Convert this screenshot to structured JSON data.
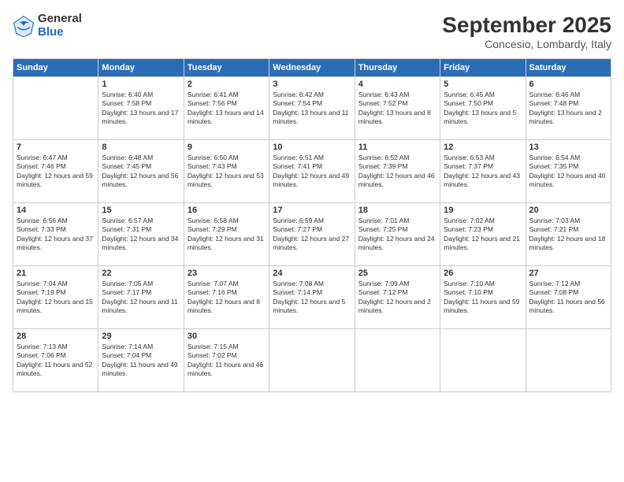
{
  "header": {
    "logo": {
      "general": "General",
      "blue": "Blue"
    },
    "title": "September 2025",
    "location": "Concesio, Lombardy, Italy"
  },
  "weekdays": [
    "Sunday",
    "Monday",
    "Tuesday",
    "Wednesday",
    "Thursday",
    "Friday",
    "Saturday"
  ],
  "weeks": [
    [
      null,
      {
        "day": "1",
        "sunrise": "6:40 AM",
        "sunset": "7:58 PM",
        "daylight": "13 hours and 17 minutes."
      },
      {
        "day": "2",
        "sunrise": "6:41 AM",
        "sunset": "7:56 PM",
        "daylight": "13 hours and 14 minutes."
      },
      {
        "day": "3",
        "sunrise": "6:42 AM",
        "sunset": "7:54 PM",
        "daylight": "13 hours and 11 minutes."
      },
      {
        "day": "4",
        "sunrise": "6:43 AM",
        "sunset": "7:52 PM",
        "daylight": "13 hours and 8 minutes."
      },
      {
        "day": "5",
        "sunrise": "6:45 AM",
        "sunset": "7:50 PM",
        "daylight": "13 hours and 5 minutes."
      },
      {
        "day": "6",
        "sunrise": "6:46 AM",
        "sunset": "7:48 PM",
        "daylight": "13 hours and 2 minutes."
      }
    ],
    [
      {
        "day": "7",
        "sunrise": "6:47 AM",
        "sunset": "7:46 PM",
        "daylight": "12 hours and 59 minutes."
      },
      {
        "day": "8",
        "sunrise": "6:48 AM",
        "sunset": "7:45 PM",
        "daylight": "12 hours and 56 minutes."
      },
      {
        "day": "9",
        "sunrise": "6:50 AM",
        "sunset": "7:43 PM",
        "daylight": "12 hours and 53 minutes."
      },
      {
        "day": "10",
        "sunrise": "6:51 AM",
        "sunset": "7:41 PM",
        "daylight": "12 hours and 49 minutes."
      },
      {
        "day": "11",
        "sunrise": "6:52 AM",
        "sunset": "7:39 PM",
        "daylight": "12 hours and 46 minutes."
      },
      {
        "day": "12",
        "sunrise": "6:53 AM",
        "sunset": "7:37 PM",
        "daylight": "12 hours and 43 minutes."
      },
      {
        "day": "13",
        "sunrise": "6:54 AM",
        "sunset": "7:35 PM",
        "daylight": "12 hours and 40 minutes."
      }
    ],
    [
      {
        "day": "14",
        "sunrise": "6:56 AM",
        "sunset": "7:33 PM",
        "daylight": "12 hours and 37 minutes."
      },
      {
        "day": "15",
        "sunrise": "6:57 AM",
        "sunset": "7:31 PM",
        "daylight": "12 hours and 34 minutes."
      },
      {
        "day": "16",
        "sunrise": "6:58 AM",
        "sunset": "7:29 PM",
        "daylight": "12 hours and 31 minutes."
      },
      {
        "day": "17",
        "sunrise": "6:59 AM",
        "sunset": "7:27 PM",
        "daylight": "12 hours and 27 minutes."
      },
      {
        "day": "18",
        "sunrise": "7:01 AM",
        "sunset": "7:25 PM",
        "daylight": "12 hours and 24 minutes."
      },
      {
        "day": "19",
        "sunrise": "7:02 AM",
        "sunset": "7:23 PM",
        "daylight": "12 hours and 21 minutes."
      },
      {
        "day": "20",
        "sunrise": "7:03 AM",
        "sunset": "7:21 PM",
        "daylight": "12 hours and 18 minutes."
      }
    ],
    [
      {
        "day": "21",
        "sunrise": "7:04 AM",
        "sunset": "7:19 PM",
        "daylight": "12 hours and 15 minutes."
      },
      {
        "day": "22",
        "sunrise": "7:05 AM",
        "sunset": "7:17 PM",
        "daylight": "12 hours and 11 minutes."
      },
      {
        "day": "23",
        "sunrise": "7:07 AM",
        "sunset": "7:16 PM",
        "daylight": "12 hours and 8 minutes."
      },
      {
        "day": "24",
        "sunrise": "7:08 AM",
        "sunset": "7:14 PM",
        "daylight": "12 hours and 5 minutes."
      },
      {
        "day": "25",
        "sunrise": "7:09 AM",
        "sunset": "7:12 PM",
        "daylight": "12 hours and 2 minutes."
      },
      {
        "day": "26",
        "sunrise": "7:10 AM",
        "sunset": "7:10 PM",
        "daylight": "11 hours and 59 minutes."
      },
      {
        "day": "27",
        "sunrise": "7:12 AM",
        "sunset": "7:08 PM",
        "daylight": "11 hours and 56 minutes."
      }
    ],
    [
      {
        "day": "28",
        "sunrise": "7:13 AM",
        "sunset": "7:06 PM",
        "daylight": "11 hours and 52 minutes."
      },
      {
        "day": "29",
        "sunrise": "7:14 AM",
        "sunset": "7:04 PM",
        "daylight": "11 hours and 49 minutes."
      },
      {
        "day": "30",
        "sunrise": "7:15 AM",
        "sunset": "7:02 PM",
        "daylight": "11 hours and 46 minutes."
      },
      null,
      null,
      null,
      null
    ]
  ],
  "labels": {
    "sunrise": "Sunrise:",
    "sunset": "Sunset:",
    "daylight": "Daylight:"
  }
}
